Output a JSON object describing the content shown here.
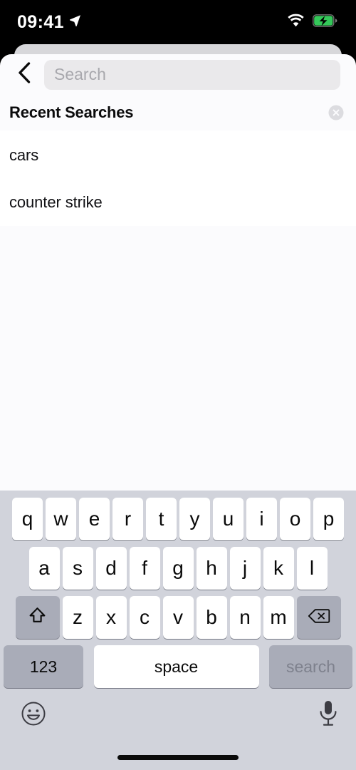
{
  "status_bar": {
    "time": "09:41",
    "location_icon": "location-arrow-icon",
    "wifi_icon": "wifi-icon",
    "battery_icon": "battery-charging-icon",
    "battery_color": "#34c759"
  },
  "search_header": {
    "back_icon": "chevron-left-icon",
    "search_value": "",
    "search_placeholder": "Search"
  },
  "recent": {
    "title": "Recent Searches",
    "clear_icon": "clear-circle-icon",
    "items": [
      {
        "label": "cars"
      },
      {
        "label": "counter strike"
      }
    ]
  },
  "keyboard": {
    "row1": [
      "q",
      "w",
      "e",
      "r",
      "t",
      "y",
      "u",
      "i",
      "o",
      "p"
    ],
    "row2": [
      "a",
      "s",
      "d",
      "f",
      "g",
      "h",
      "j",
      "k",
      "l"
    ],
    "row3": [
      "z",
      "x",
      "c",
      "v",
      "b",
      "n",
      "m"
    ],
    "shift_icon": "shift-arrow-icon",
    "delete_icon": "backspace-delete-icon",
    "numbers_label": "123",
    "space_label": "space",
    "return_label": "search",
    "emoji_icon": "smiley-face-icon",
    "dictation_icon": "microphone-icon"
  },
  "home_indicator": "home-indicator"
}
